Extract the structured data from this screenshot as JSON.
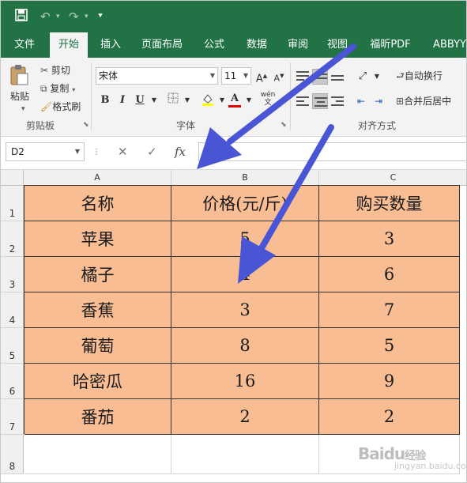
{
  "quick_access": {
    "save_icon": "save-icon",
    "undo_icon": "undo-icon",
    "redo_icon": "redo-icon"
  },
  "tabs": [
    "文件",
    "开始",
    "插入",
    "页面布局",
    "公式",
    "数据",
    "审阅",
    "视图",
    "福昕PDF",
    "ABBYY"
  ],
  "active_tab": "开始",
  "ribbon": {
    "paste_label": "粘贴",
    "cut_label": "剪切",
    "copy_label": "复制",
    "format_painter_label": "格式刷",
    "clipboard_group": "剪贴板",
    "font_name": "宋体",
    "font_size": "11",
    "font_grow": "A",
    "font_shrink": "A",
    "bold": "B",
    "italic": "I",
    "underline": "U",
    "phonetic_label": "wén",
    "font_group": "字体",
    "wrap_text_label": "自动换行",
    "merge_center_label": "合并后居中",
    "alignment_group": "对齐方式"
  },
  "formula_bar": {
    "name_box": "D2",
    "cancel_symbol": "✕",
    "enter_symbol": "✓",
    "fx_symbol": "fx",
    "value": ""
  },
  "sheet": {
    "columns": [
      "A",
      "B",
      "C"
    ],
    "row_numbers": [
      "1",
      "2",
      "3",
      "4",
      "5",
      "6",
      "7",
      "8"
    ],
    "header": [
      "名称",
      "价格(元/斤)",
      "购买数量"
    ],
    "rows": [
      [
        "苹果",
        "5",
        "3"
      ],
      [
        "橘子",
        "4",
        "6"
      ],
      [
        "香蕉",
        "3",
        "7"
      ],
      [
        "葡萄",
        "8",
        "5"
      ],
      [
        "哈密瓜",
        "16",
        "9"
      ],
      [
        "番茄",
        "2",
        "2"
      ]
    ],
    "fill_color": "#f8bd92"
  },
  "colors": {
    "excel_green": "#217346",
    "annotation_arrow": "#4a55d6"
  },
  "watermark": {
    "brand": "Baidu",
    "sub": "经验",
    "url": "jingyan.baidu.com"
  }
}
